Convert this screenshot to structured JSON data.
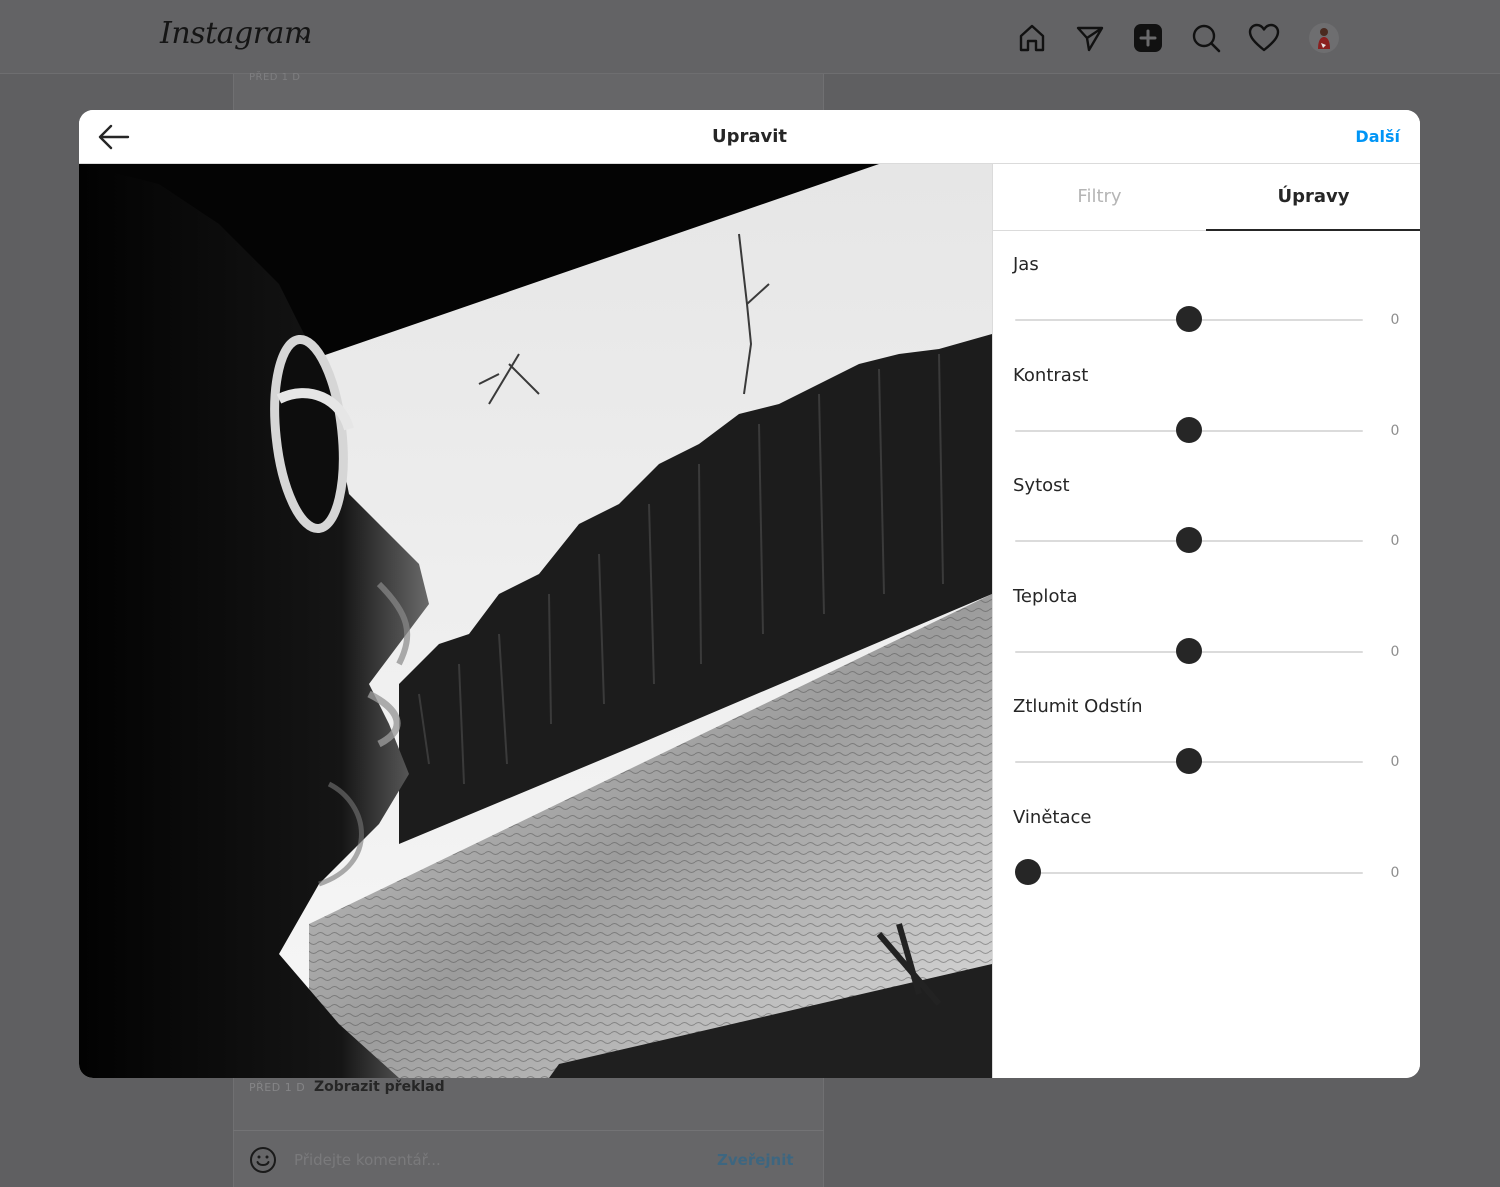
{
  "app": {
    "logo_text": "Instagram",
    "nav_icons": [
      "home-icon",
      "direct-messages-icon",
      "new-post-icon",
      "explore-icon",
      "activity-heart-icon"
    ]
  },
  "background_post": {
    "time_top": "PŘED 1 D",
    "time_bottom": "PŘED 1 D",
    "translate_label": "Zobrazit překlad",
    "comment_placeholder": "Přidejte komentář...",
    "post_button": "Zveřejnit"
  },
  "modal": {
    "title": "Upravit",
    "next_label": "Další",
    "tabs": [
      {
        "label": "Filtry",
        "active": false
      },
      {
        "label": "Úpravy",
        "active": true
      }
    ],
    "adjustments": [
      {
        "label": "Jas",
        "value": "0",
        "slider_position": 0.5
      },
      {
        "label": "Kontrast",
        "value": "0",
        "slider_position": 0.5
      },
      {
        "label": "Sytost",
        "value": "0",
        "slider_position": 0.5
      },
      {
        "label": "Teplota",
        "value": "0",
        "slider_position": 0.5
      },
      {
        "label": "Ztlumit Odstín",
        "value": "0",
        "slider_position": 0.5
      },
      {
        "label": "Vinětace",
        "value": "0",
        "slider_position": 0.0
      }
    ]
  },
  "colors": {
    "accent": "#0095f6",
    "text": "#262626",
    "muted": "#8e8e8e",
    "divider": "#dbdbdb",
    "overlay": "#5f5f61"
  }
}
